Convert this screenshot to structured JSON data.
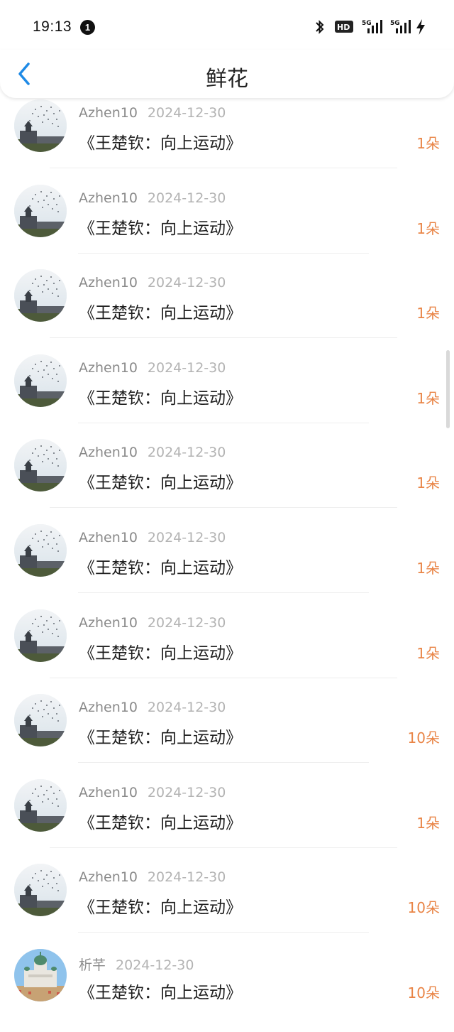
{
  "status_bar": {
    "time": "19:13",
    "notification_count": "1",
    "icons": [
      "bluetooth-icon",
      "hd-voice-icon",
      "5g-signal-icon",
      "5g-signal-icon",
      "charging-icon"
    ]
  },
  "header": {
    "title": "鲜花",
    "back_icon": "chevron-left-icon"
  },
  "colors": {
    "accent": "#1e8ae6",
    "count": "#e98547",
    "username": "#8a8a8a",
    "date": "#b3b3b3"
  },
  "list": [
    {
      "user": "Azhen10",
      "date": "2024-12-30",
      "title": "《王楚钦：向上运动》",
      "count": "1朵",
      "avatar": "birds-sky-building"
    },
    {
      "user": "Azhen10",
      "date": "2024-12-30",
      "title": "《王楚钦：向上运动》",
      "count": "1朵",
      "avatar": "birds-sky-building"
    },
    {
      "user": "Azhen10",
      "date": "2024-12-30",
      "title": "《王楚钦：向上运动》",
      "count": "1朵",
      "avatar": "birds-sky-building"
    },
    {
      "user": "Azhen10",
      "date": "2024-12-30",
      "title": "《王楚钦：向上运动》",
      "count": "1朵",
      "avatar": "birds-sky-building"
    },
    {
      "user": "Azhen10",
      "date": "2024-12-30",
      "title": "《王楚钦：向上运动》",
      "count": "1朵",
      "avatar": "birds-sky-building"
    },
    {
      "user": "Azhen10",
      "date": "2024-12-30",
      "title": "《王楚钦：向上运动》",
      "count": "1朵",
      "avatar": "birds-sky-building"
    },
    {
      "user": "Azhen10",
      "date": "2024-12-30",
      "title": "《王楚钦：向上运动》",
      "count": "1朵",
      "avatar": "birds-sky-building"
    },
    {
      "user": "Azhen10",
      "date": "2024-12-30",
      "title": "《王楚钦：向上运动》",
      "count": "10朵",
      "avatar": "birds-sky-building"
    },
    {
      "user": "Azhen10",
      "date": "2024-12-30",
      "title": "《王楚钦：向上运动》",
      "count": "1朵",
      "avatar": "birds-sky-building"
    },
    {
      "user": "Azhen10",
      "date": "2024-12-30",
      "title": "《王楚钦：向上运动》",
      "count": "10朵",
      "avatar": "birds-sky-building"
    },
    {
      "user": "析芊",
      "date": "2024-12-30",
      "title": "《王楚钦：向上运动》",
      "count": "10朵",
      "avatar": "cathedral-square"
    }
  ]
}
